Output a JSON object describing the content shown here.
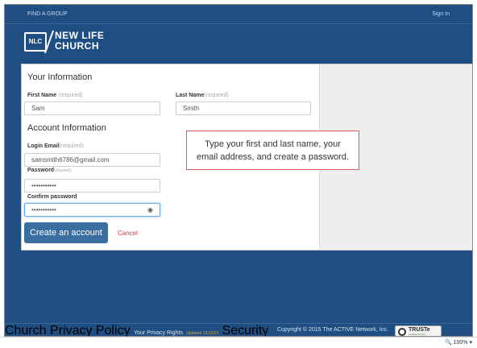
{
  "nav": {
    "left": "FIND A GROUP",
    "right": "Sign In"
  },
  "logo": {
    "badge": "NLC",
    "line1": "NEW LIFE",
    "line2": "CHURCH"
  },
  "form": {
    "section1": "Your Information",
    "first_name_label": "First Name",
    "first_name_req": "(required)",
    "first_name_value": "Sam",
    "last_name_label": "Last Name",
    "last_name_req": "(required)",
    "last_name_value": "Smith",
    "section2": "Account Information",
    "email_label": "Login Email",
    "email_req": "(required)",
    "email_value": "samsmith6786@gmail.com",
    "password_label": "Password",
    "password_req": "(required)",
    "password_value": "•••••••••••",
    "confirm_label": "Confirm password",
    "confirm_value": "•••••••••••",
    "create_btn": "Create an account",
    "cancel": "Cancel"
  },
  "callout": {
    "line1": "Type your first and last name, your",
    "line2": "email address, and create a password."
  },
  "footer": {
    "privacy_policy": "Church Privacy Policy",
    "privacy_rights": "Your Privacy Rights",
    "updated": "Updated 12/12/13",
    "security": "Security",
    "copyright": "Copyright © 2015 The ACTIVE Network, Inc.",
    "truste": "TRUSTe",
    "truste_sub": "Certified Privacy"
  },
  "status": {
    "zoom": "100%"
  }
}
